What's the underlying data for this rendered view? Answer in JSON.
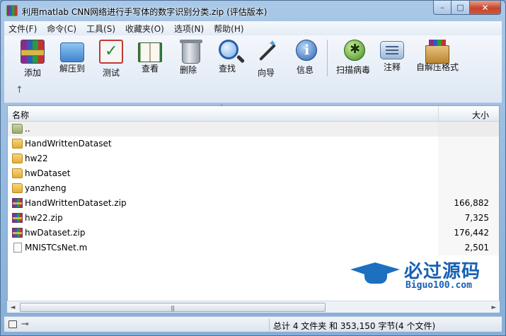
{
  "window": {
    "title": "利用matlab CNN网络进行手写体的数字识别分类.zip (评估版本)",
    "controls": {
      "minimize": "–",
      "maximize": "□",
      "close": "✕"
    }
  },
  "menu": [
    "文件(F)",
    "命令(C)",
    "工具(S)",
    "收藏夹(O)",
    "选项(N)",
    "帮助(H)"
  ],
  "toolbar": {
    "buttons": [
      {
        "label": "添加",
        "icon": "archive-add-icon"
      },
      {
        "label": "解压到",
        "icon": "folder-extract-icon"
      },
      {
        "label": "测试",
        "icon": "checklist-test-icon"
      },
      {
        "label": "查看",
        "icon": "book-view-icon"
      },
      {
        "label": "删除",
        "icon": "trash-icon"
      },
      {
        "label": "查找",
        "icon": "magnifier-icon"
      },
      {
        "label": "向导",
        "icon": "magic-wand-icon"
      },
      {
        "label": "信息",
        "icon": "info-icon"
      },
      {
        "label": "扫描病毒",
        "icon": "bug-scan-icon"
      },
      {
        "label": "注释",
        "icon": "comment-icon"
      },
      {
        "label": "自解压格式",
        "icon": "sfx-box-icon"
      }
    ],
    "up_arrow": "↑"
  },
  "list": {
    "headers": {
      "name": "名称",
      "size": "大小",
      "sort_indicator": "˄"
    },
    "rows": [
      {
        "name": "..",
        "size": "",
        "type": "up"
      },
      {
        "name": "HandWrittenDataset",
        "size": "",
        "type": "folder"
      },
      {
        "name": "hw22",
        "size": "",
        "type": "folder"
      },
      {
        "name": "hwDataset",
        "size": "",
        "type": "folder"
      },
      {
        "name": "yanzheng",
        "size": "",
        "type": "folder"
      },
      {
        "name": "HandWrittenDataset.zip",
        "size": "166,882",
        "type": "rar"
      },
      {
        "name": "hw22.zip",
        "size": "7,325",
        "type": "rar"
      },
      {
        "name": "hwDataset.zip",
        "size": "176,442",
        "type": "rar"
      },
      {
        "name": "MNISTCsNet.m",
        "size": "2,501",
        "type": "m"
      }
    ]
  },
  "watermark": {
    "big": "必过源码",
    "small": "Biguo100.com"
  },
  "scrollbar": {
    "left": "◄",
    "right": "►",
    "grip": "|||"
  },
  "status": {
    "key_icon": "⊸",
    "text": "总计 4 文件夹 和 353,150 字节(4 个文件)"
  }
}
